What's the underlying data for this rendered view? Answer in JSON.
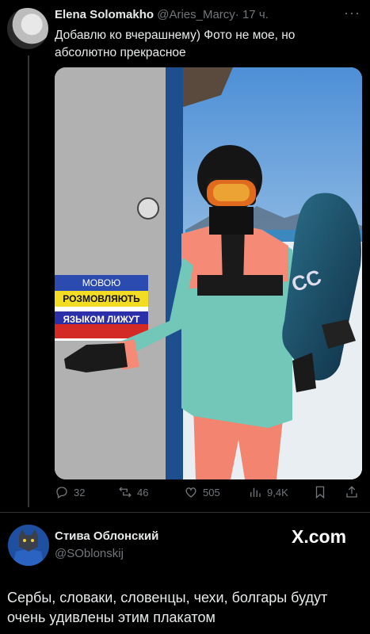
{
  "tweet": {
    "author_name": "Elena Solomakho",
    "handle": "@Aries_Marcy",
    "separator": "·",
    "time": "17 ч.",
    "more": "···",
    "text": "Добавлю ко вчерашнему) Фото не мое, но абсолютно прекрасное",
    "photo": {
      "poster_line1": "МОВОЮ",
      "poster_line2": "РОЗМОВЛЯЮТЬ",
      "poster_line3": "ЯЗЫКОМ ЛИЖУТ",
      "board_logo": "CC"
    },
    "actions": {
      "replies": "32",
      "retweets": "46",
      "likes": "505",
      "views": "9,4K"
    }
  },
  "quote": {
    "name": "Стива Облонский",
    "handle": "@SOblonskij",
    "site": "X.com",
    "text": "Сербы, словаки, словенцы, чехи, болгары будут очень удивлены этим плакатом"
  },
  "colors": {
    "background": "#000000",
    "text": "#e7e9ea",
    "secondary": "#71767b"
  }
}
